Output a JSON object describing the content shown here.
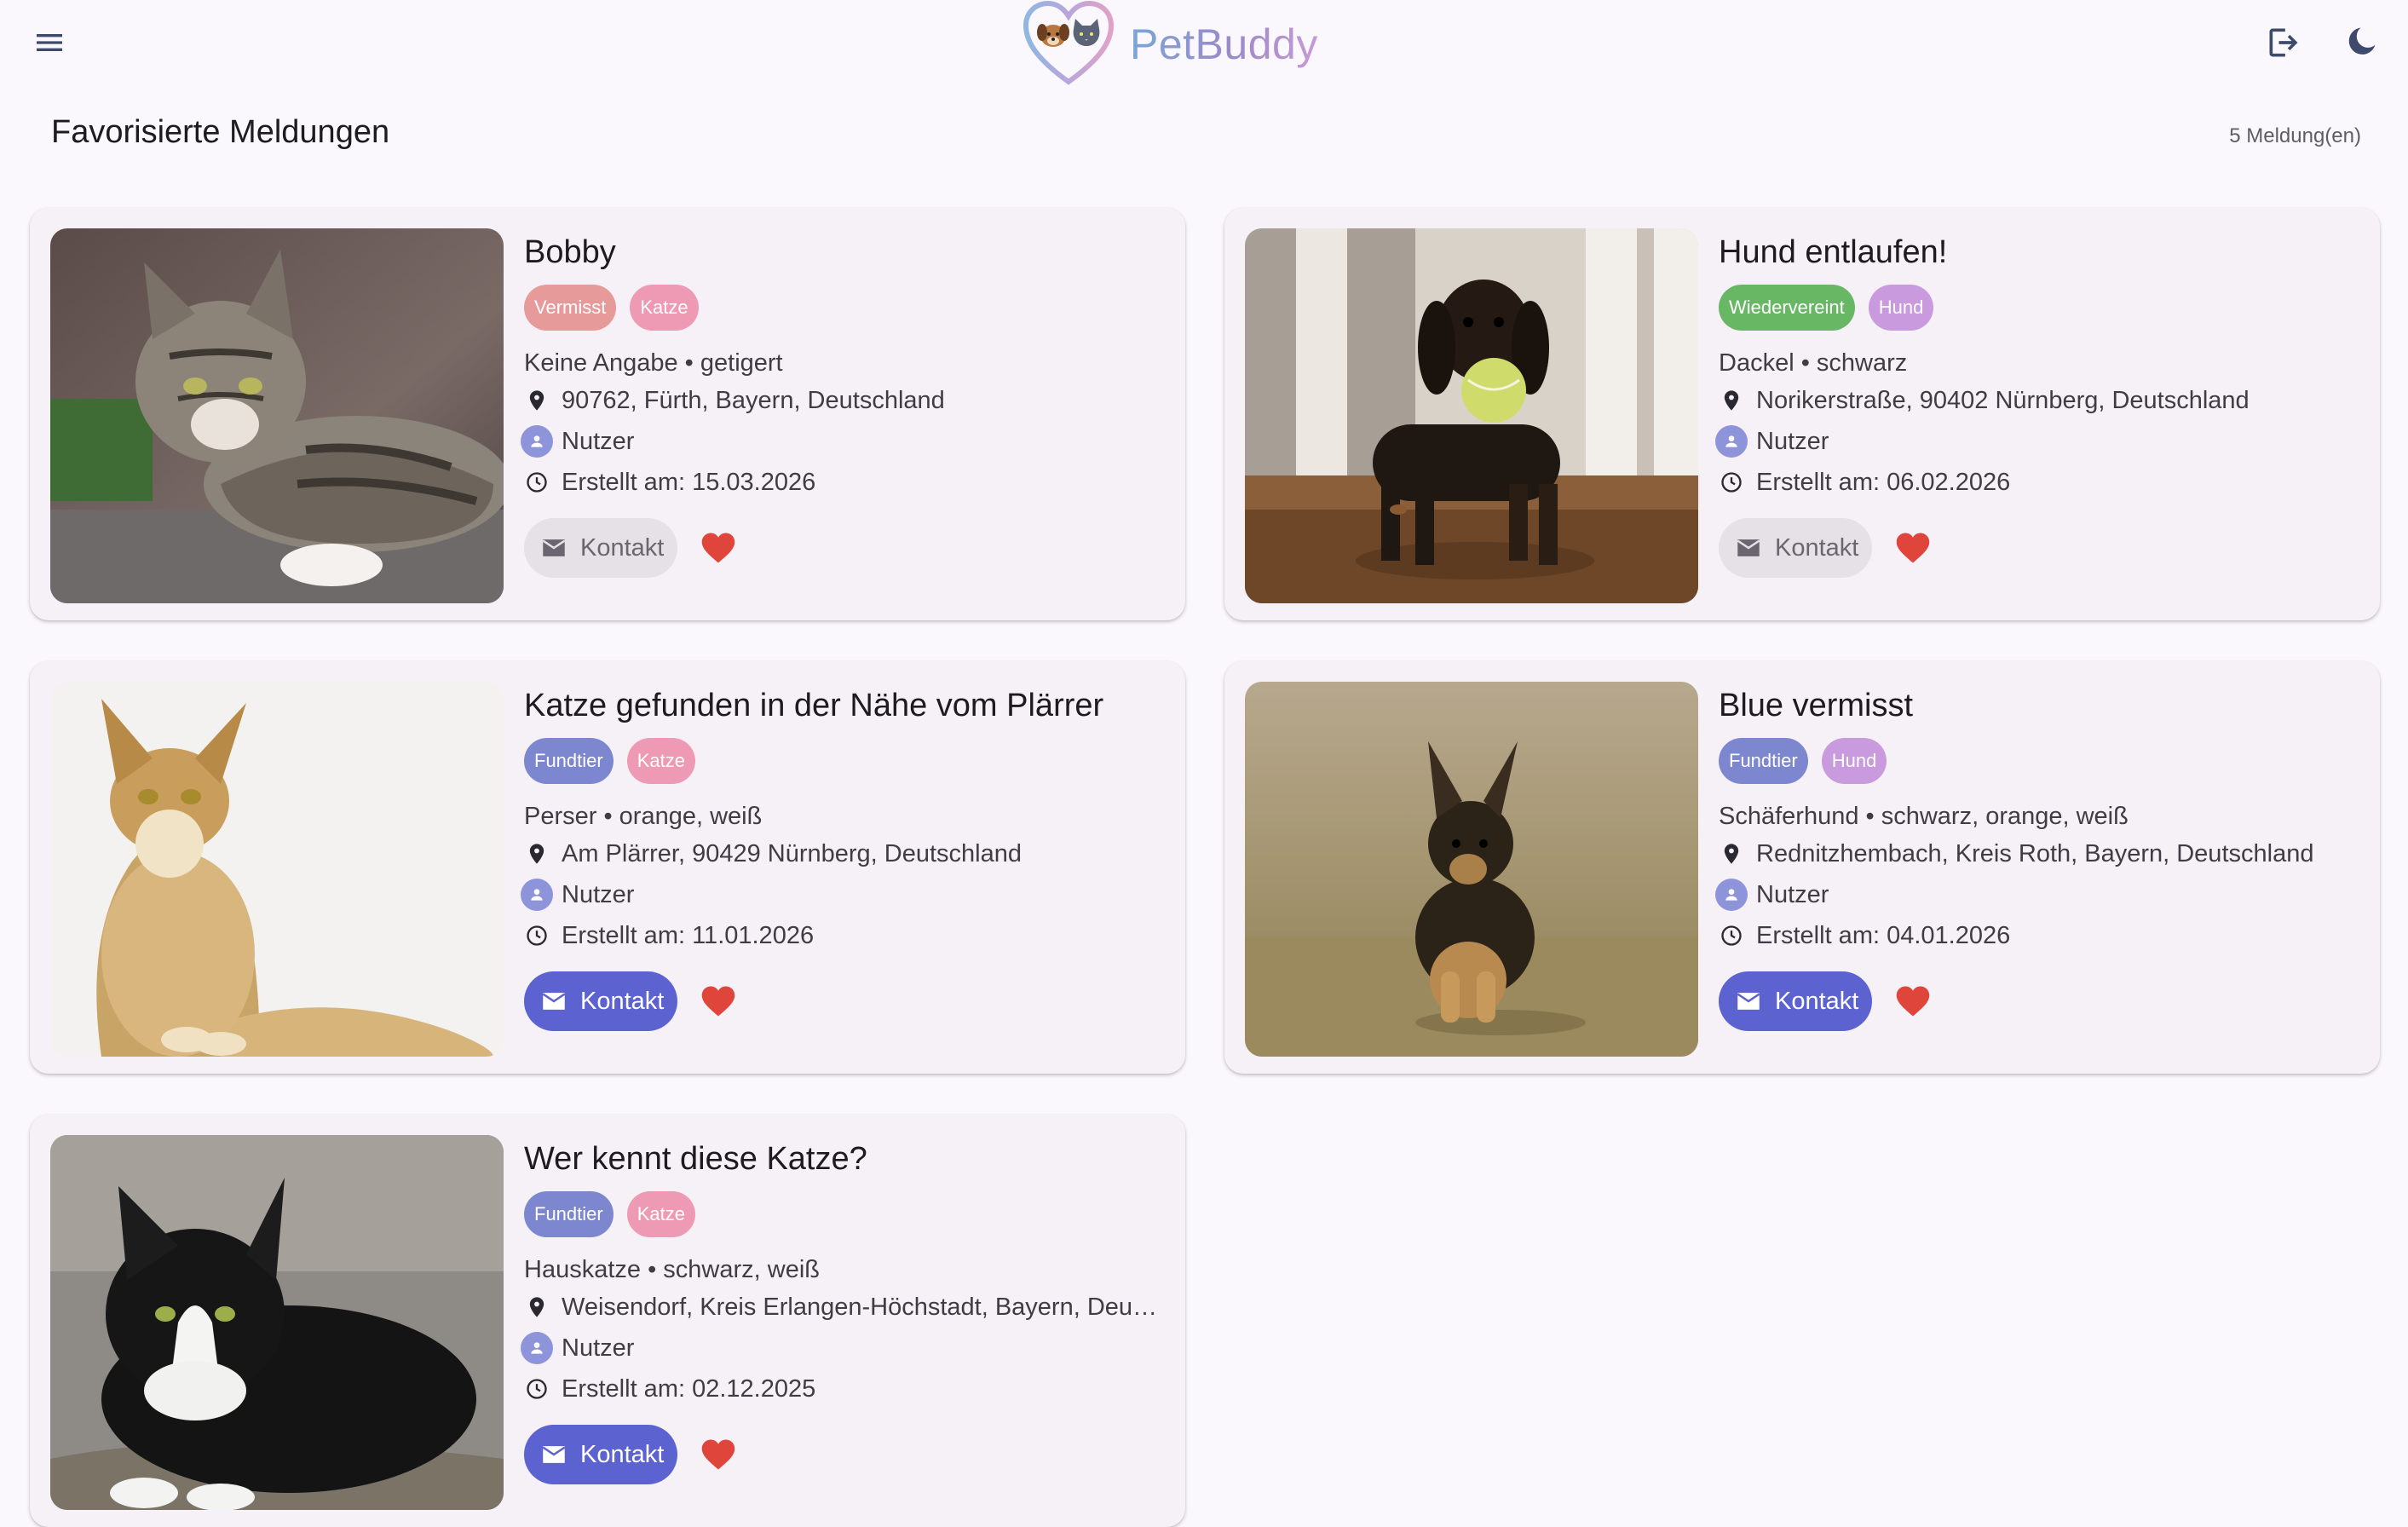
{
  "header": {
    "brand": "PetBuddy",
    "menu_icon": "menu-icon",
    "logout_icon": "logout-icon",
    "theme_icon": "dark-mode-moon-icon"
  },
  "page": {
    "title": "Favorisierte Meldungen",
    "count": "5 Meldung(en)"
  },
  "colors": {
    "primary": "#5d62d1",
    "vermisst": "#e79a9a",
    "katze": "#ee9ab5",
    "hund": "#c99add",
    "wiedervereint": "#68b765",
    "fundtier": "#7c87cf",
    "favorite": "#e0453b"
  },
  "cards": [
    {
      "title": "Bobby",
      "status": "Vermisst",
      "species": "Katze",
      "breed_color": "Keine Angabe • getigert",
      "location": "90762, Fürth, Bayern, Deutschland",
      "user": "Nutzer",
      "created": "Erstellt am: 15.03.2026",
      "contact": "Kontakt",
      "contact_enabled": false,
      "photo": "tabby cat lying"
    },
    {
      "title": "Hund entlaufen!",
      "status": "Wiedervereint",
      "species": "Hund",
      "breed_color": "Dackel • schwarz",
      "location": "Norikerstraße, 90402 Nürnberg, Deutschland",
      "user": "Nutzer",
      "created": "Erstellt am: 06.02.2026",
      "contact": "Kontakt",
      "contact_enabled": false,
      "photo": "dachshund holding tennis ball"
    },
    {
      "title": "Katze gefunden in der Nähe vom Plärrer",
      "status": "Fundtier",
      "species": "Katze",
      "breed_color": "Perser • orange, weiß",
      "location": "Am Plärrer, 90429 Nürnberg, Deutschland",
      "user": "Nutzer",
      "created": "Erstellt am: 11.01.2026",
      "contact": "Kontakt",
      "contact_enabled": true,
      "photo": "long-haired orange cat sitting"
    },
    {
      "title": "Blue vermisst",
      "status": "Fundtier",
      "species": "Hund",
      "breed_color": "Schäferhund • schwarz, orange, weiß",
      "location": "Rednitzhembach, Kreis Roth, Bayern, Deutschland",
      "user": "Nutzer",
      "created": "Erstellt am: 04.01.2026",
      "contact": "Kontakt",
      "contact_enabled": true,
      "photo": "german shepherd puppy running"
    },
    {
      "title": "Wer kennt diese Katze?",
      "status": "Fundtier",
      "species": "Katze",
      "breed_color": "Hauskatze • schwarz, weiß",
      "location": "Weisendorf, Kreis Erlangen-Höchstadt, Bayern, Deuts...",
      "user": "Nutzer",
      "created": "Erstellt am: 02.12.2025",
      "contact": "Kontakt",
      "contact_enabled": true,
      "photo": "black and white cat crouching"
    }
  ]
}
